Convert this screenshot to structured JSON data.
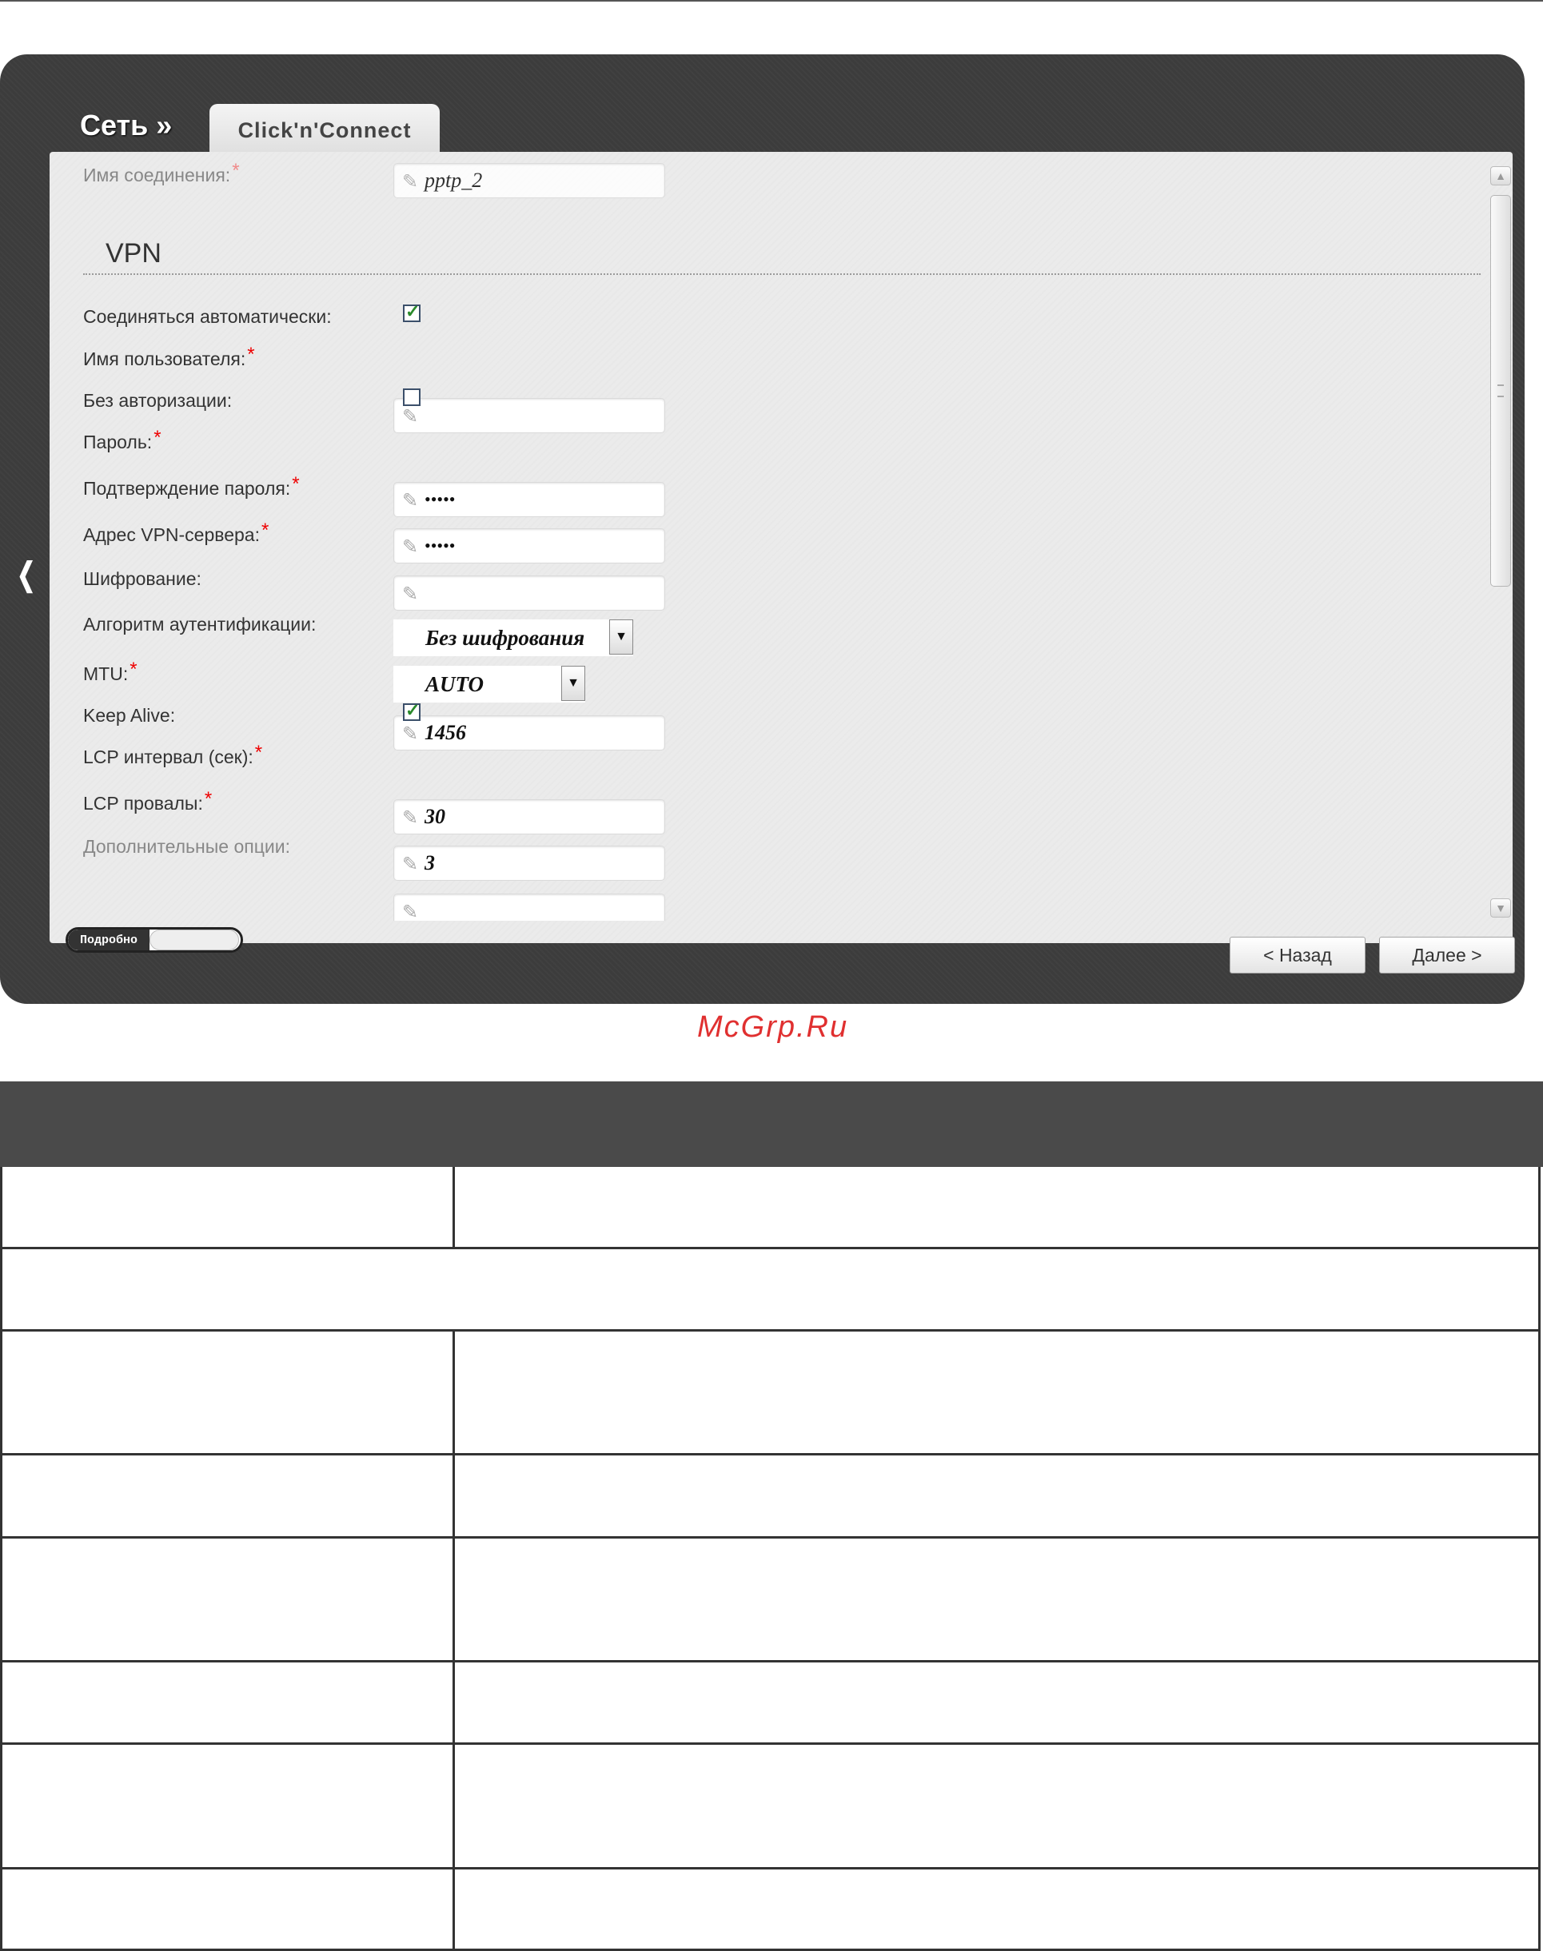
{
  "ui": {
    "section_title": "Сеть »",
    "tab_label": "Click'n'Connect",
    "connection_name": {
      "label": "Имя соединения:",
      "value": "pptp_2",
      "required": "*"
    },
    "vpn_heading": "VPN",
    "fields": {
      "auto_connect": {
        "label": "Соединяться автоматически:",
        "checked": true
      },
      "username": {
        "label": "Имя пользователя:",
        "required": "*",
        "value": ""
      },
      "no_auth": {
        "label": "Без авторизации:",
        "checked": false
      },
      "password": {
        "label": "Пароль:",
        "required": "*",
        "value": "•••••"
      },
      "password_confirm": {
        "label": "Подтверждение пароля:",
        "required": "*",
        "value": "•••••"
      },
      "vpn_server": {
        "label": "Адрес VPN-сервера:",
        "required": "*",
        "value": ""
      },
      "encryption": {
        "label": "Шифрование:",
        "value": "Без шифрования"
      },
      "auth_algorithm": {
        "label": "Алгоритм аутентификации:",
        "value": "AUTO"
      },
      "mtu": {
        "label": "MTU:",
        "required": "*",
        "value": "1456"
      },
      "keep_alive": {
        "label": "Keep Alive:",
        "checked": true
      },
      "lcp_interval": {
        "label": "LCP интервал (сек):",
        "required": "*",
        "value": "30"
      },
      "lcp_failures": {
        "label": "LCP провалы:",
        "required": "*",
        "value": "3"
      },
      "extra_options": {
        "label": "Дополнительные опции:",
        "value": ""
      }
    },
    "details_toggle": "Подробно",
    "back_button": "< Назад",
    "next_button": "Далее >",
    "watermark": "McGrp.Ru"
  },
  "icons": {
    "pencil": "pencil-icon",
    "back_arrow": "chevron-left-icon",
    "dropdown": "triangle-down-icon",
    "check": "checkmark-icon"
  },
  "colors": {
    "frame": "#3c3c3c",
    "panel": "#ebebeb",
    "required": "#e00000",
    "table_header": "#4a4a4a",
    "watermark": "#e03030"
  }
}
